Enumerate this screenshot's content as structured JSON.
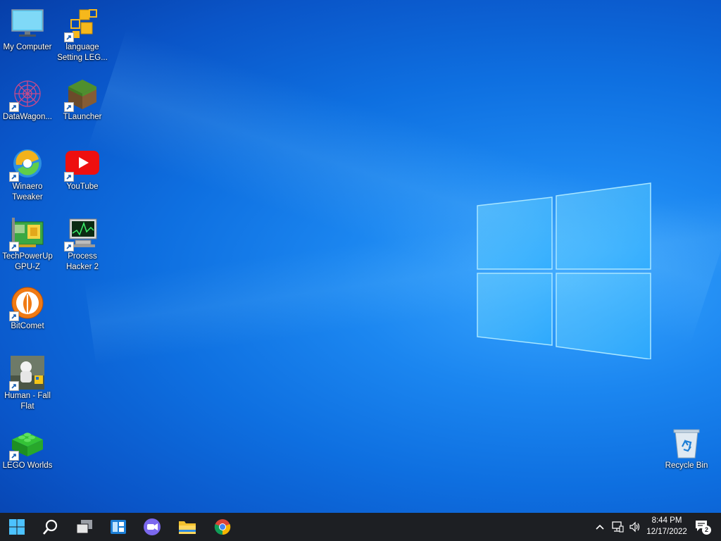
{
  "desktop": {
    "icons": [
      {
        "label": "My Computer",
        "icon": "monitor-icon"
      },
      {
        "label": "language Setting LEG...",
        "icon": "language-setting-icon"
      },
      {
        "label": "DataWagon...",
        "icon": "datawagon-icon"
      },
      {
        "label": "TLauncher",
        "icon": "tlauncher-icon"
      },
      {
        "label": "Winaero Tweaker",
        "icon": "winaero-tweaker-icon"
      },
      {
        "label": "YouTube",
        "icon": "youtube-icon"
      },
      {
        "label": "TechPowerUp GPU-Z",
        "icon": "gpu-z-icon"
      },
      {
        "label": "Process Hacker 2",
        "icon": "process-hacker-icon"
      },
      {
        "label": "BitComet",
        "icon": "bitcomet-icon"
      },
      {
        "label": "Human - Fall Flat",
        "icon": "human-fall-flat-icon"
      },
      {
        "label": "LEGO Worlds",
        "icon": "lego-worlds-icon"
      },
      {
        "label": "Recycle Bin",
        "icon": "recycle-bin-icon"
      }
    ]
  },
  "taskbar": {
    "buttons": [
      "start-icon",
      "search-icon",
      "task-view-icon",
      "widgets-icon",
      "chat-icon",
      "file-explorer-icon",
      "chrome-icon"
    ],
    "tray": {
      "icons": [
        "show-hidden-icons-chevron",
        "network-icon",
        "volume-icon"
      ],
      "time": "8:44 PM",
      "date": "12/17/2022",
      "notification_count": "2"
    }
  },
  "colors": {
    "taskbar": "#1d1f23",
    "desktop_accent": "#0e6fe0",
    "windows_logo": "#2fb0ff"
  }
}
